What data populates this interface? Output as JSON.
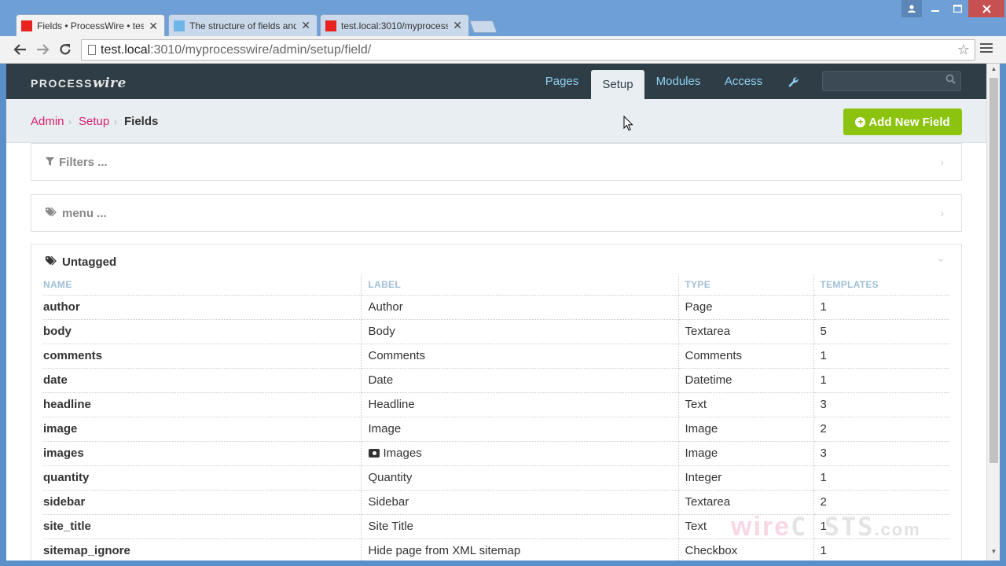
{
  "browser": {
    "tabs": [
      {
        "title": "Fields • ProcessWire • test",
        "favicon_color": "#e8231f",
        "active": true
      },
      {
        "title": "The structure of fields and",
        "favicon_color": "#6fb6e8",
        "active": false
      },
      {
        "title": "test.local:3010/myprocess",
        "favicon_color": "#e8231f",
        "active": false
      }
    ],
    "url_host": "test.local",
    "url_path": ":3010/myprocesswire/admin/setup/field/"
  },
  "app": {
    "logo_process": "PROCESS",
    "logo_wire": "wire",
    "nav": {
      "pages": "Pages",
      "setup": "Setup",
      "modules": "Modules",
      "access": "Access"
    },
    "search_placeholder": ""
  },
  "breadcrumb": {
    "admin": "Admin",
    "setup": "Setup",
    "current": "Fields"
  },
  "add_button": "Add New Field",
  "filters_label": "Filters ...",
  "menu_label": "menu ...",
  "untagged_label": "Untagged",
  "table": {
    "headers": [
      "NAME",
      "LABEL",
      "TYPE",
      "TEMPLATES"
    ],
    "rows": [
      {
        "name": "author",
        "label": "Author",
        "type": "Page",
        "templates": "1"
      },
      {
        "name": "body",
        "label": "Body",
        "type": "Textarea",
        "templates": "5"
      },
      {
        "name": "comments",
        "label": "Comments",
        "type": "Comments",
        "templates": "1"
      },
      {
        "name": "date",
        "label": "Date",
        "type": "Datetime",
        "templates": "1"
      },
      {
        "name": "headline",
        "label": "Headline",
        "type": "Text",
        "templates": "3"
      },
      {
        "name": "image",
        "label": "Image",
        "type": "Image",
        "templates": "2"
      },
      {
        "name": "images",
        "label": "Images",
        "type": "Image",
        "templates": "3",
        "label_icon": "camera-icon"
      },
      {
        "name": "quantity",
        "label": "Quantity",
        "type": "Integer",
        "templates": "1"
      },
      {
        "name": "sidebar",
        "label": "Sidebar",
        "type": "Textarea",
        "templates": "2"
      },
      {
        "name": "site_title",
        "label": "Site Title",
        "type": "Text",
        "templates": "1"
      },
      {
        "name": "sitemap_ignore",
        "label": "Hide page from XML sitemap",
        "type": "Checkbox",
        "templates": "1"
      }
    ]
  },
  "watermark": {
    "wire": "wire",
    "casts": "C STS",
    "com": ".com"
  },
  "colors": {
    "accent_link": "#d6216d",
    "masthead": "#2f3d46",
    "add_button": "#8cc30f",
    "nav_link": "#8fd0f0",
    "header_text": "#9fbfd6"
  }
}
